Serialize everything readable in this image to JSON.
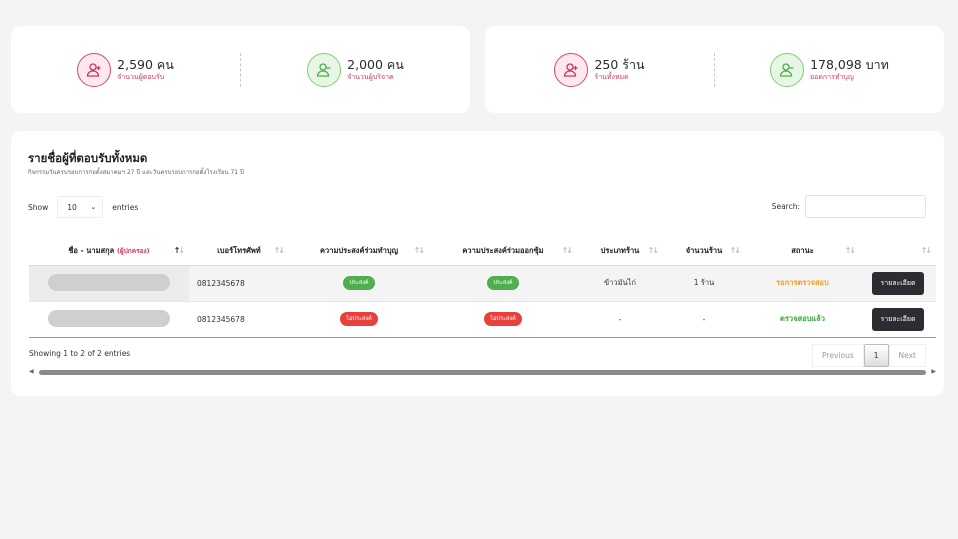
{
  "stats_left": [
    {
      "value": "2,590 คน",
      "label": "จำนวนผู้ตอบรับ",
      "icon": "person-add-icon",
      "color": "red"
    },
    {
      "value": "2,000 คน",
      "label": "จำนวนผู้บริจาค",
      "icon": "person-remove-icon",
      "color": "green"
    }
  ],
  "stats_right": [
    {
      "value": "250 ร้าน",
      "label": "ร้านทั้งหมด",
      "icon": "person-add-icon",
      "color": "red"
    },
    {
      "value": "178,098 บาท",
      "label": "ยอดการทำบุญ",
      "icon": "person-remove-icon",
      "color": "green"
    }
  ],
  "main": {
    "title": "รายชื่อผู้ที่ตอบรับทั้งหมด",
    "subtitle": "กิจกรรมวันครบรอบการก่อตั้งสมาคมฯ 27 ปี และวันครบรอบการก่อตั้งโรงเรียน 71 ปี",
    "show_label": "Show",
    "entries_value": "10",
    "entries_label": "entries",
    "search_label": "Search:",
    "columns": {
      "name": "ชื่อ - นามสกุล",
      "name_sub": "(ผู้ปกครอง)",
      "phone": "เบอร์โทรศัพท์",
      "merit": "ความประสงค์ร่วมทำบุญ",
      "booth": "ความประสงค์ร่วมออกซุ้ม",
      "shop_type": "ประเภทร้าน",
      "shop_count": "จำนวนร้าน",
      "status": "สถานะ"
    },
    "rows": [
      {
        "phone": "0812345678",
        "merit": "ประสงค์",
        "booth": "ประสงค์",
        "shop_type": "ข้าวมันไก่",
        "shop_count": "1 ร้าน",
        "status": "รอการตรวจสอบ",
        "action": "รายละเอียด"
      },
      {
        "phone": "0812345678",
        "merit": "ไม่ประสงค์",
        "booth": "ไม่ประสงค์",
        "shop_type": "-",
        "shop_count": "-",
        "status": "ตรวจสอบแล้ว",
        "action": "รายละเอียด"
      }
    ],
    "footer_info": "Showing 1 to 2 of 2 entries",
    "pager": {
      "previous": "Previous",
      "current": "1",
      "next": "Next"
    }
  }
}
